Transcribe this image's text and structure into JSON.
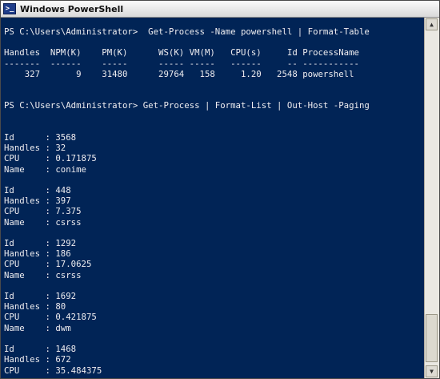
{
  "window": {
    "title": "Windows PowerShell",
    "icon": "powershell-icon"
  },
  "console_text": "PS C:\\Users\\Administrator>  Get-Process -Name powershell | Format-Table\n\nHandles  NPM(K)    PM(K)      WS(K) VM(M)   CPU(s)     Id ProcessName\n-------  ------    -----      ----- -----   ------     -- -----------\n    327       9    31480      29764   158     1.20   2548 powershell\n\n\nPS C:\\Users\\Administrator> Get-Process | Format-List | Out-Host -Paging\n\n\nId      : 3568\nHandles : 32\nCPU     : 0.171875\nName    : conime\n\nId      : 448\nHandles : 397\nCPU     : 7.375\nName    : csrss\n\nId      : 1292\nHandles : 186\nCPU     : 17.0625\nName    : csrss\n\nId      : 1692\nHandles : 80\nCPU     : 0.421875\nName    : dwm\n\nId      : 1468\nHandles : 672\nCPU     : 35.484375",
  "scrollbar": {
    "up_icon": "arrow-up-icon",
    "down_icon": "arrow-down-icon"
  },
  "colors": {
    "console_bg": "#012456",
    "console_fg": "#eeedf0"
  }
}
